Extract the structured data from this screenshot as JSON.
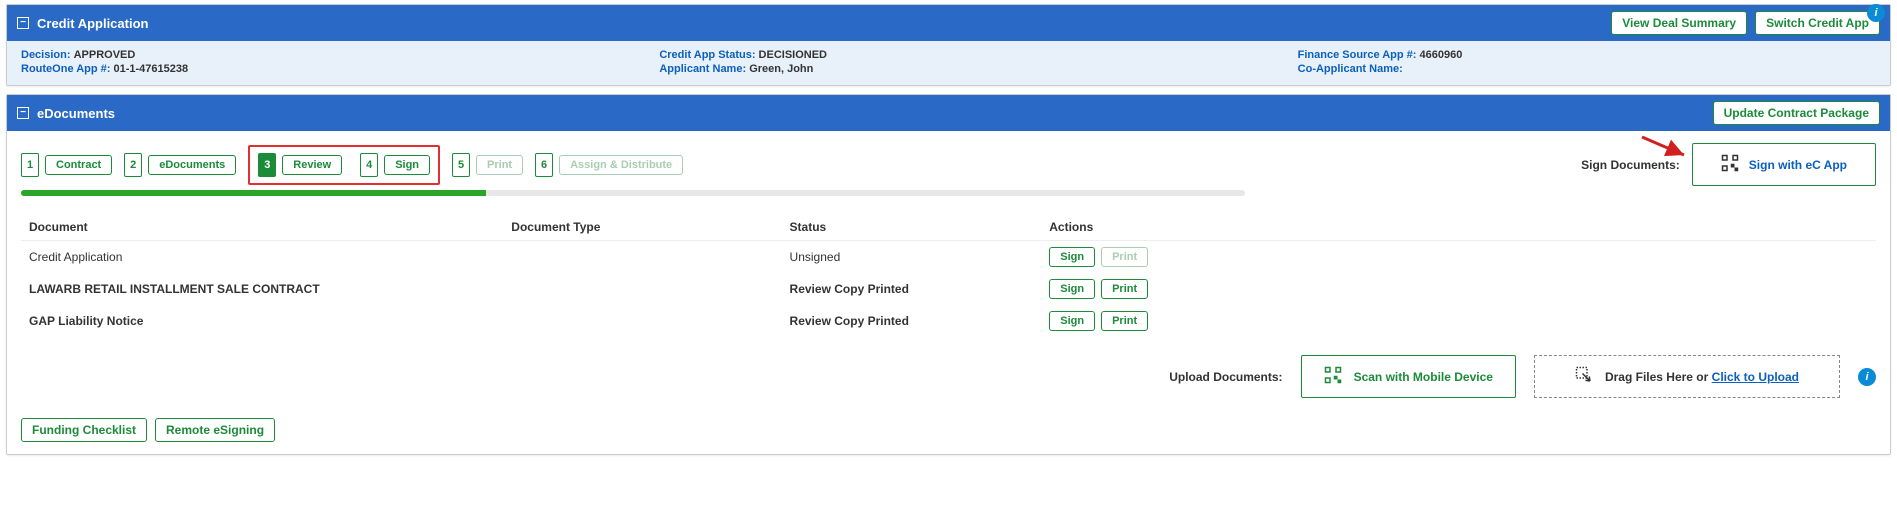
{
  "credit_app": {
    "title": "Credit Application",
    "actions": {
      "view_summary": "View Deal Summary",
      "switch_app": "Switch Credit App"
    },
    "fields": {
      "decision_label": "Decision:",
      "decision_value": "APPROVED",
      "route_label": "RouteOne App #:",
      "route_value": "01-1-47615238",
      "status_label": "Credit App Status:",
      "status_value": "DECISIONED",
      "applicant_label": "Applicant Name:",
      "applicant_value": "Green, John",
      "finance_label": "Finance Source App #:",
      "finance_value": "4660960",
      "coapp_label": "Co-Applicant Name:",
      "coapp_value": ""
    }
  },
  "edocs": {
    "title": "eDocuments",
    "update_btn": "Update Contract Package",
    "steps": {
      "s1_num": "1",
      "s1_label": "Contract",
      "s2_num": "2",
      "s2_label": "eDocuments",
      "s3_num": "3",
      "s3_label": "Review",
      "s4_num": "4",
      "s4_label": "Sign",
      "s5_num": "5",
      "s5_label": "Print",
      "s6_num": "6",
      "s6_label": "Assign & Distribute"
    },
    "sign_docs_label": "Sign Documents:",
    "sign_with_app": "Sign with eC App",
    "table": {
      "col_document": "Document",
      "col_type": "Document Type",
      "col_status": "Status",
      "col_actions": "Actions",
      "rows": [
        {
          "name": "Credit Application",
          "type": "",
          "status": "Unsigned",
          "bold": false,
          "print_enabled": false
        },
        {
          "name": "LAWARB RETAIL INSTALLMENT SALE CONTRACT",
          "type": "",
          "status": "Review Copy Printed",
          "bold": true,
          "print_enabled": true
        },
        {
          "name": "GAP Liability Notice",
          "type": "",
          "status": "Review Copy Printed",
          "bold": true,
          "print_enabled": true
        }
      ],
      "sign_btn": "Sign",
      "print_btn": "Print"
    },
    "upload_label": "Upload Documents:",
    "scan_label": "Scan with Mobile Device",
    "drop_prefix": "Drag Files Here or ",
    "drop_link": "Click to Upload",
    "funding_btn": "Funding Checklist",
    "remote_btn": "Remote eSigning"
  }
}
